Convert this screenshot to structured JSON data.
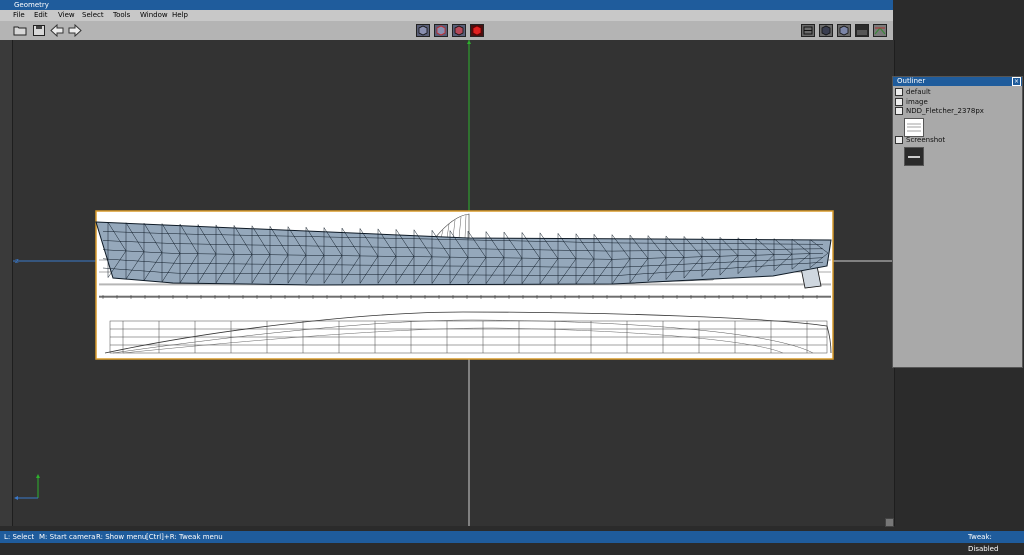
{
  "window": {
    "title": "Geometry"
  },
  "menu": [
    "File",
    "Edit",
    "View",
    "Select",
    "Tools",
    "Window",
    "Help"
  ],
  "toolbar": {
    "left_buttons": [
      "open-folder-icon",
      "save-icon",
      "undo-arrow-icon",
      "redo-arrow-icon"
    ],
    "center_buttons": [
      "select-vertex-icon",
      "select-edge-icon",
      "select-face-icon",
      "select-object-icon"
    ],
    "right_buttons": [
      "wireframe-view-icon",
      "shaded-view-icon",
      "solid-view-icon",
      "texture-view-icon",
      "uv-view-icon"
    ]
  },
  "viewport": {
    "axis_label": "z"
  },
  "outliner": {
    "title": "Outliner",
    "items": [
      {
        "label": "default",
        "icon": "checkbox-icon"
      },
      {
        "label": "image",
        "icon": "checkbox-icon"
      },
      {
        "label": "NDD_Fletcher_2378px",
        "icon": "image-node-icon"
      },
      {
        "label": "Screenshot",
        "icon": "image-node-icon"
      }
    ]
  },
  "statusbar": {
    "hints": [
      "L: Select",
      "M: Start camera",
      "R: Show menu",
      "[Ctrl]+R: Tweak menu"
    ],
    "tweak_status": "Tweak: Disabled"
  },
  "colors": {
    "title_bar": "#1f5c9c",
    "viewport_bg": "#333333",
    "mesh": "#1a2a3a",
    "mesh_fill": "#8fa6bd",
    "image_border": "#d89a2a"
  }
}
